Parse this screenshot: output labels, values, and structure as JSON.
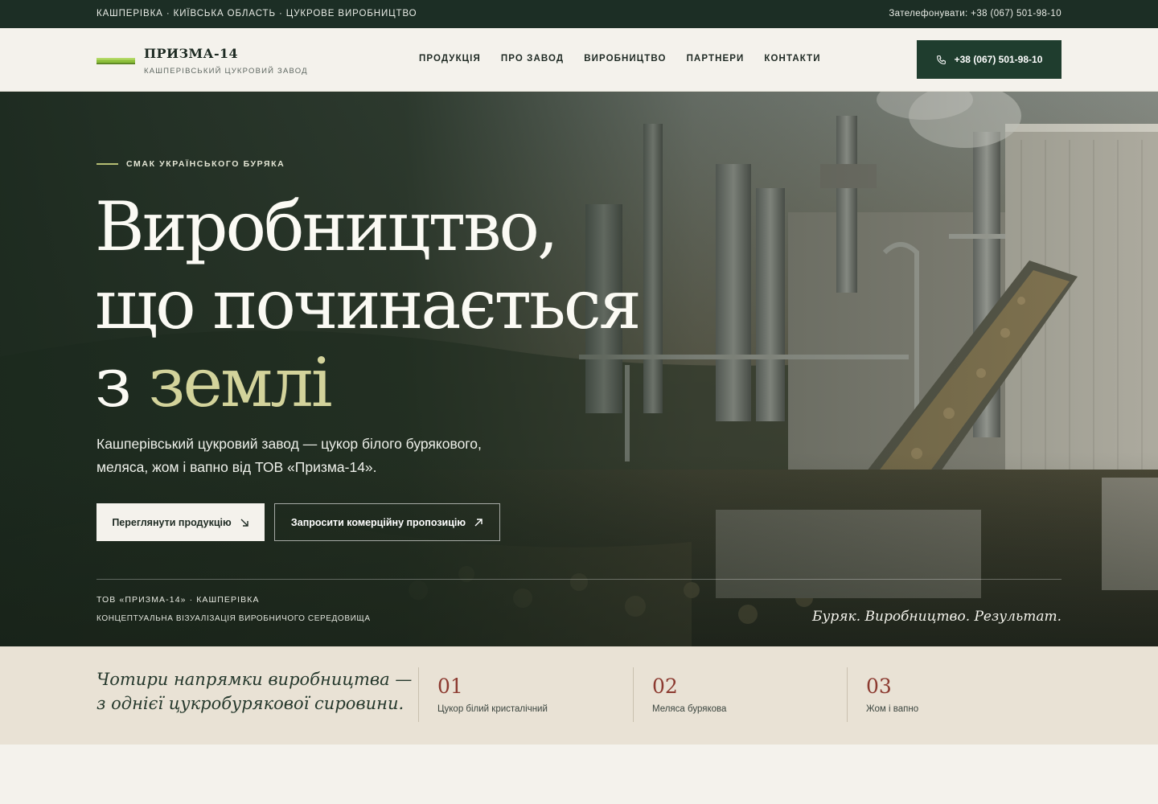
{
  "topbar": {
    "location": "КАШПЕРІВКА · КИЇВСЬКА ОБЛАСТЬ · ЦУКРОВЕ ВИРОБНИЦТВО",
    "phone": "Зателефонувати: +38 (067) 501-98-10"
  },
  "header": {
    "logo_title": "ПРИЗМА-14",
    "logo_subtitle": "КАШПЕРІВСЬКИЙ ЦУКРОВИЙ ЗАВОД",
    "nav": [
      "ПРОДУКЦІЯ",
      "ПРО ЗАВОД",
      "ВИРОБНИЦТВО",
      "ПАРТНЕРИ",
      "КОНТАКТИ"
    ],
    "cta_phone": "+38 (067) 501-98-10"
  },
  "hero": {
    "eyebrow": "СМАК УКРАЇНСЬКОГО БУРЯКА",
    "headline_line1": "Виробництво,",
    "headline_line2": "що починається",
    "headline_line3_prefix": "з ",
    "headline_line3_accent": "землі",
    "lead": "Кашперівський цукровий завод — цукор білого бурякового, меляса, жом і вапно від ТОВ «Призма-14».",
    "btn_primary": "Переглянути продукцію",
    "btn_secondary": "Запросити комерційну пропозицію",
    "footer_company": "ТОВ «ПРИЗМА-14» · КАШПЕРІВКА",
    "footer_note": "КОНЦЕПТУАЛЬНА ВІЗУАЛІЗАЦІЯ ВИРОБНИЧОГО СЕРЕДОВИЩА",
    "tagline": "Буряк. Виробництво. Результат."
  },
  "directions": {
    "intro_line1": "Чотири напрямки виробництва —",
    "intro_line2": "з однієї цукробурякової сировини.",
    "items": [
      {
        "num": "01",
        "label": "Цукор білий кристалічний"
      },
      {
        "num": "02",
        "label": "Меляса бурякова"
      },
      {
        "num": "03",
        "label": "Жом і вапно"
      }
    ]
  },
  "colors": {
    "dark_green": "#1c2e25",
    "button_green": "#1f3d2e",
    "accent_olive": "#d3d39b",
    "number_red": "#8c3a30",
    "beige": "#e9e2d5"
  },
  "icons": [
    "logo-mark-icon",
    "phone-icon",
    "arrow-down-right-icon",
    "arrow-up-right-icon"
  ]
}
